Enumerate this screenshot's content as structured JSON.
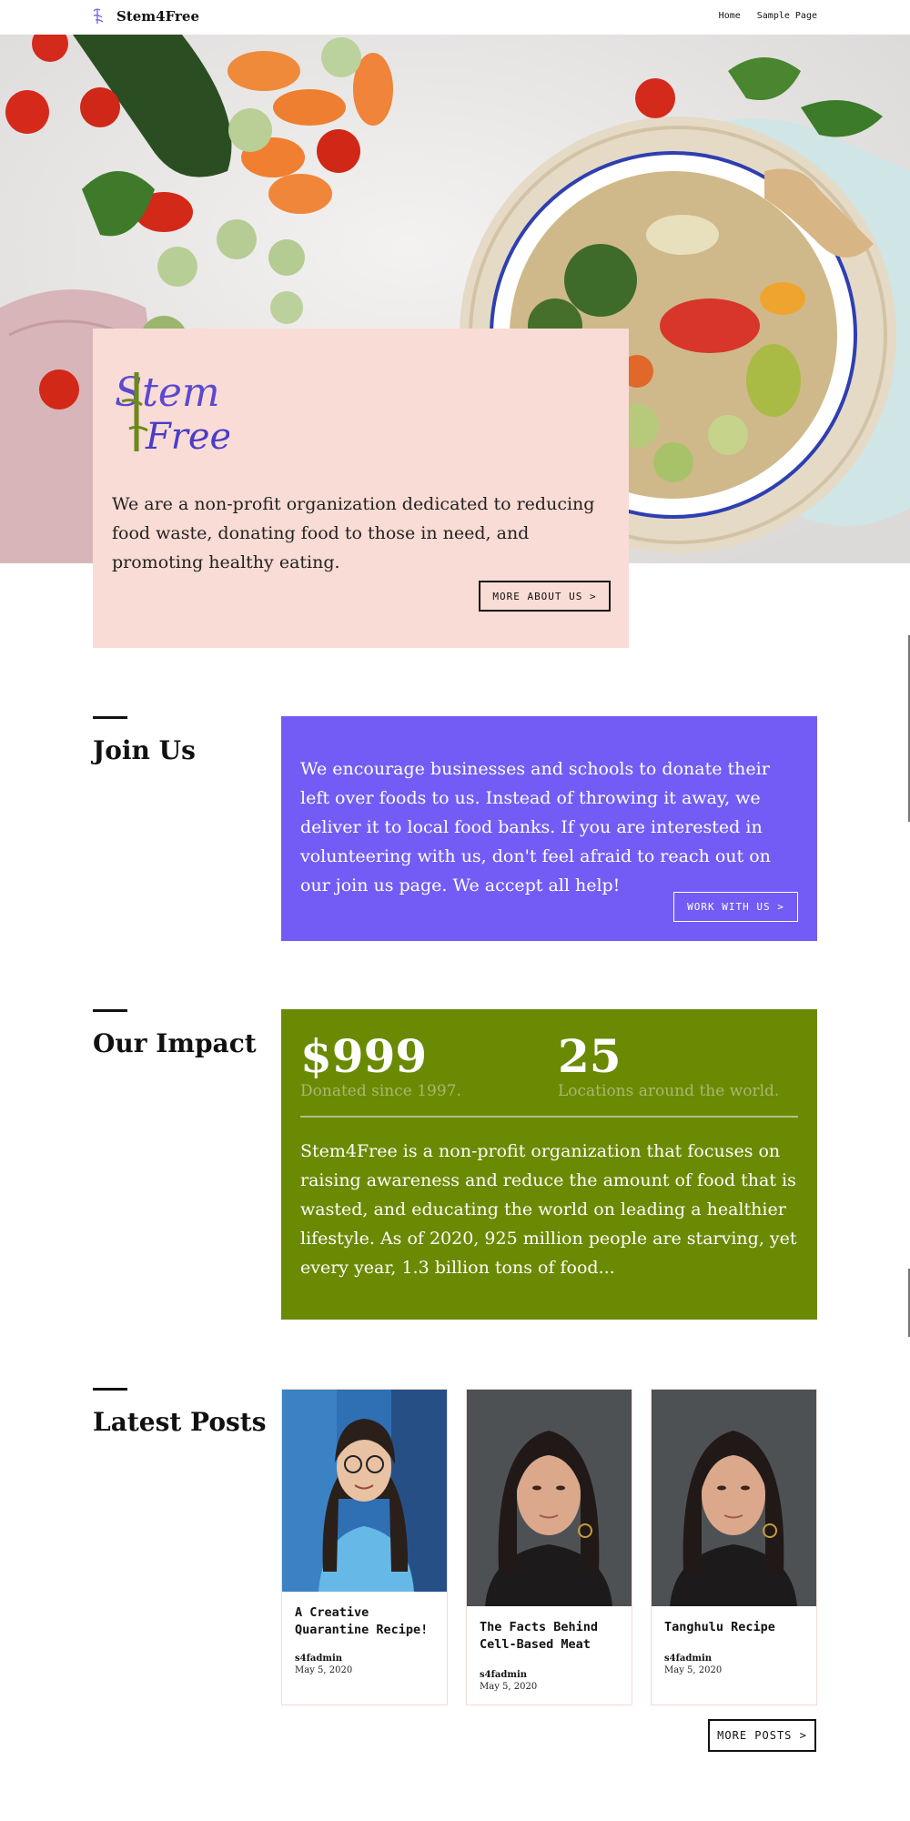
{
  "header": {
    "brand": "Stem4Free",
    "nav": [
      "Home",
      "Sample Page"
    ]
  },
  "intro": {
    "logo_text_line1": "Stem",
    "logo_text_line2": "Free",
    "text": "We are a non-profit organization dedicated to reducing food waste, donating food to those in need, and promoting healthy eating.",
    "button": "MORE ABOUT US >"
  },
  "join": {
    "title": "Join Us",
    "text": "We encourage businesses and schools to donate their left over foods to us. Instead of throwing it away, we deliver it to local food banks. If you are interested in volunteering with us, don't feel afraid to reach out on our join us page. We accept all help!",
    "button": "WORK WITH US >"
  },
  "impact": {
    "title": "Our Impact",
    "stat1_value": "$999",
    "stat1_label": "Donated since 1997.",
    "stat2_value": "25",
    "stat2_label": "Locations around the world.",
    "text": "Stem4Free is a non-profit organization that focuses on raising awareness and reduce the amount of food that is wasted, and educating the world on leading a healthier lifestyle. As of 2020, 925 million people are starving, yet every year, 1.3 billion tons of food..."
  },
  "posts": {
    "title": "Latest Posts",
    "items": [
      {
        "title": "A Creative Quarantine Recipe!",
        "author": "s4fadmin",
        "date": "May 5, 2020"
      },
      {
        "title": "The Facts Behind Cell-Based Meat",
        "author": "s4fadmin",
        "date": "May 5, 2020"
      },
      {
        "title": "Tanghulu Recipe",
        "author": "s4fadmin",
        "date": "May 5, 2020"
      }
    ],
    "button": "MORE POSTS >"
  },
  "colors": {
    "intro_bg": "#f9dcd5",
    "join_bg": "#735cf5",
    "impact_bg": "#6b8a03"
  }
}
